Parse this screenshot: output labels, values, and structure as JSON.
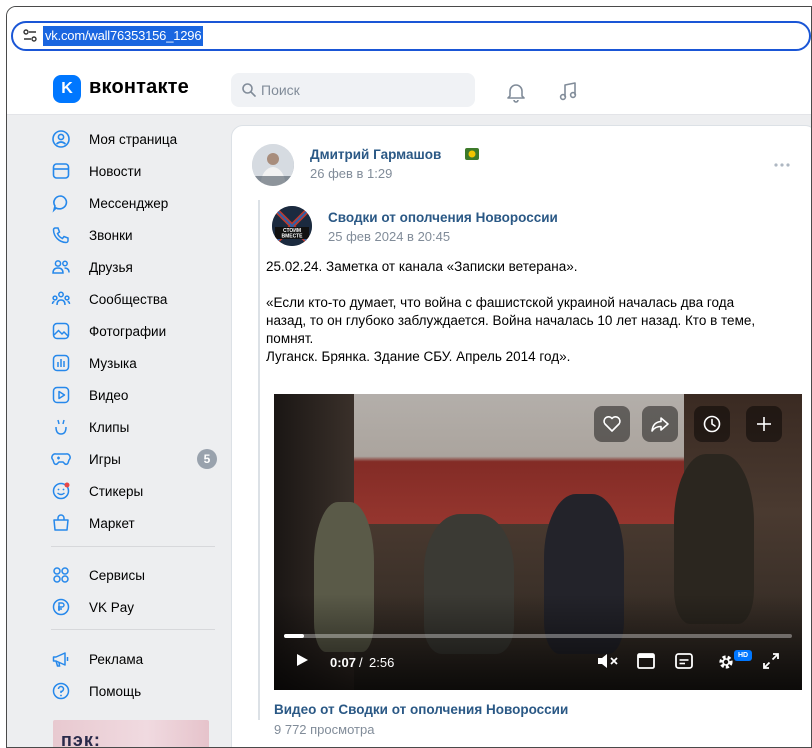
{
  "browser": {
    "url": "vk.com/wall76353156_1296"
  },
  "header": {
    "logo": "K",
    "brand": "вконтакте",
    "search_placeholder": "Поиск"
  },
  "sidebar": {
    "items": [
      {
        "label": "Моя страница",
        "icon": "user-circle-icon"
      },
      {
        "label": "Новости",
        "icon": "news-icon"
      },
      {
        "label": "Мессенджер",
        "icon": "message-icon"
      },
      {
        "label": "Звонки",
        "icon": "phone-icon"
      },
      {
        "label": "Друзья",
        "icon": "friends-icon"
      },
      {
        "label": "Сообщества",
        "icon": "communities-icon"
      },
      {
        "label": "Фотографии",
        "icon": "photos-icon"
      },
      {
        "label": "Музыка",
        "icon": "music-icon"
      },
      {
        "label": "Видео",
        "icon": "video-icon"
      },
      {
        "label": "Клипы",
        "icon": "clips-icon"
      },
      {
        "label": "Игры",
        "icon": "games-icon",
        "badge": "5"
      },
      {
        "label": "Стикеры",
        "icon": "stickers-icon"
      },
      {
        "label": "Маркет",
        "icon": "market-icon"
      },
      {
        "label": "Сервисы",
        "icon": "services-icon"
      },
      {
        "label": "VK Pay",
        "icon": "vkpay-icon"
      },
      {
        "label": "Реклама",
        "icon": "ads-icon"
      },
      {
        "label": "Помощь",
        "icon": "help-icon"
      }
    ],
    "ad_text": "пэк:"
  },
  "post": {
    "author": "Дмитрий Гармашов",
    "date": "26 фев в 1:29",
    "repost": {
      "author": "Сводки от ополчения Новороссии",
      "date": "25 фев 2024 в 20:45",
      "avatar_text": "СТОИМ ВМЕСТЕ"
    },
    "text": {
      "line1": "25.02.24. Заметка от канала «Записки ветерана».",
      "para2_l1": "«Если кто-то думает, что война с фашистской украиной началась два года",
      "para2_l2": "назад, то он глубоко заблуждается. Война началась 10 лет назад. Кто в теме,",
      "para2_l3": "помнят.",
      "para2_l4": "Луганск. Брянка. Здание СБУ. Апрель 2014 год»."
    },
    "video": {
      "current_time": "0:07",
      "separator": "/",
      "total_time": "2:56",
      "progress": 0.04,
      "hd_label": "HD",
      "title": "Видео от Сводки от ополчения Новороссии",
      "views": "9 772 просмотра"
    }
  },
  "colors": {
    "accent": "#0077ff",
    "link": "#2a5885",
    "muted": "#818c99",
    "bg": "#edeef0"
  }
}
